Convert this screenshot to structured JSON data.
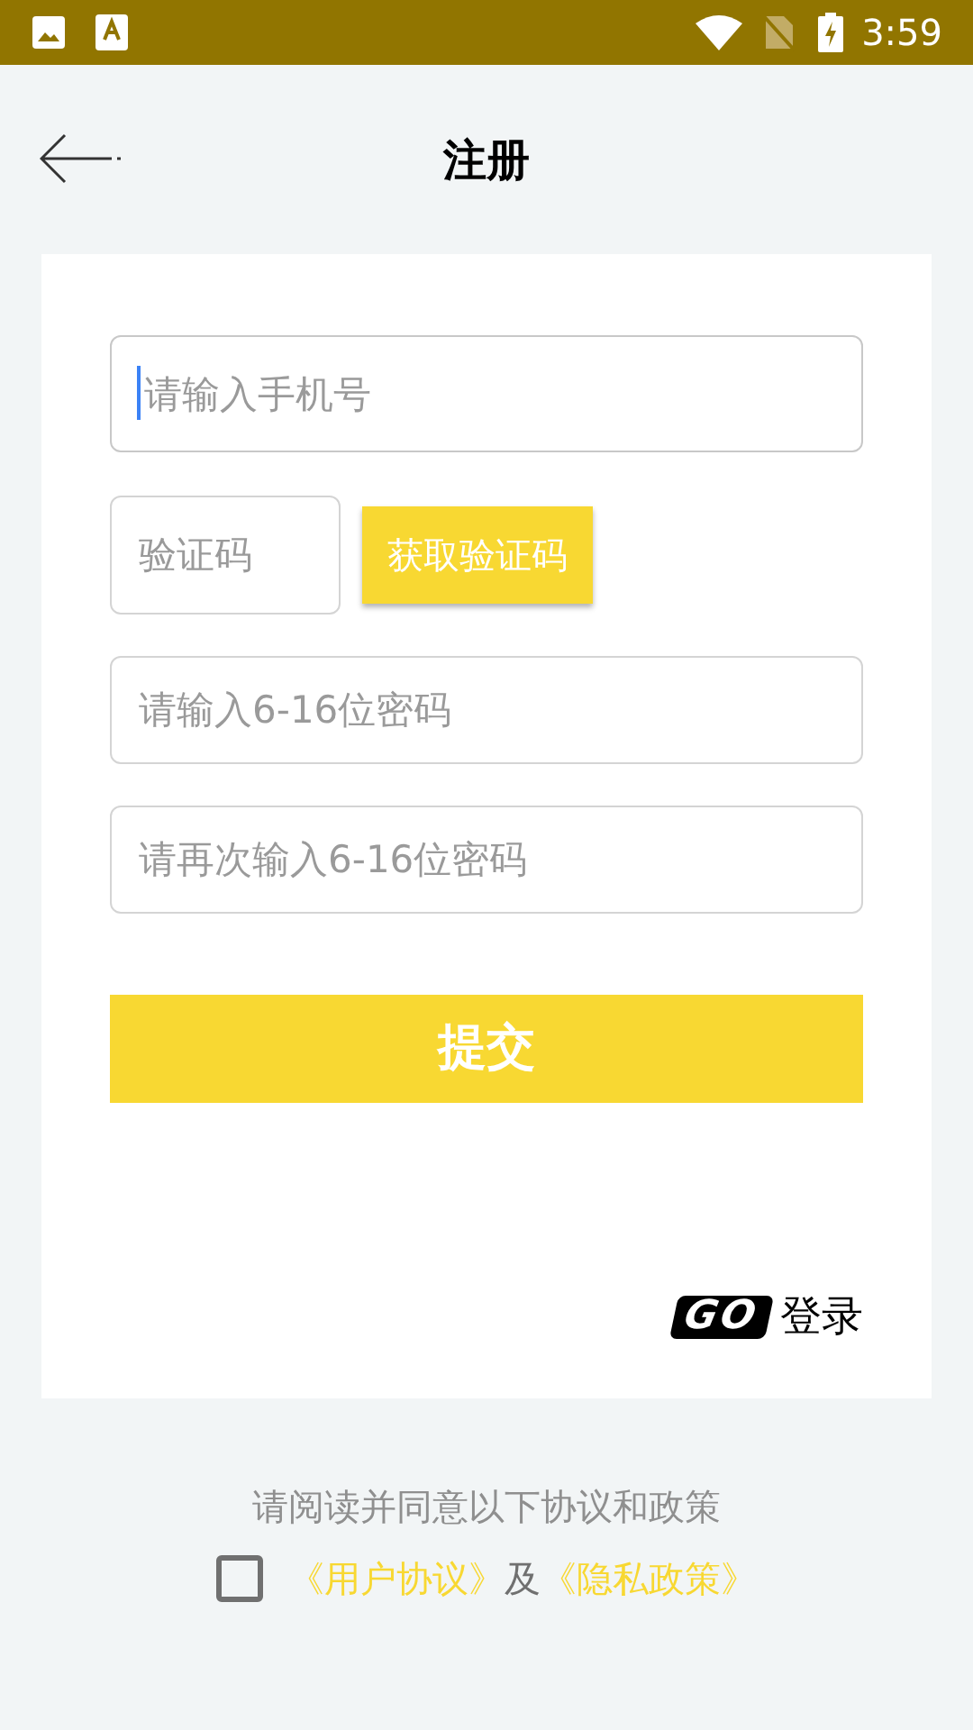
{
  "status_bar": {
    "time": "3:59"
  },
  "header": {
    "title": "注册"
  },
  "form": {
    "phone": {
      "placeholder": "请输入手机号",
      "focused": true
    },
    "code": {
      "placeholder": "验证码"
    },
    "code_button": "获取验证码",
    "password": {
      "placeholder": "请输入6-16位密码"
    },
    "confirm_password": {
      "placeholder": "请再次输入6-16位密码"
    },
    "submit": "提交",
    "login_link": {
      "logo": "GO",
      "label": "登录"
    }
  },
  "agreement": {
    "notice": "请阅读并同意以下协议和政策",
    "checked": false,
    "user_agreement": "《用户协议》",
    "conjunction": "及",
    "privacy_policy": "《隐私政策》"
  }
}
